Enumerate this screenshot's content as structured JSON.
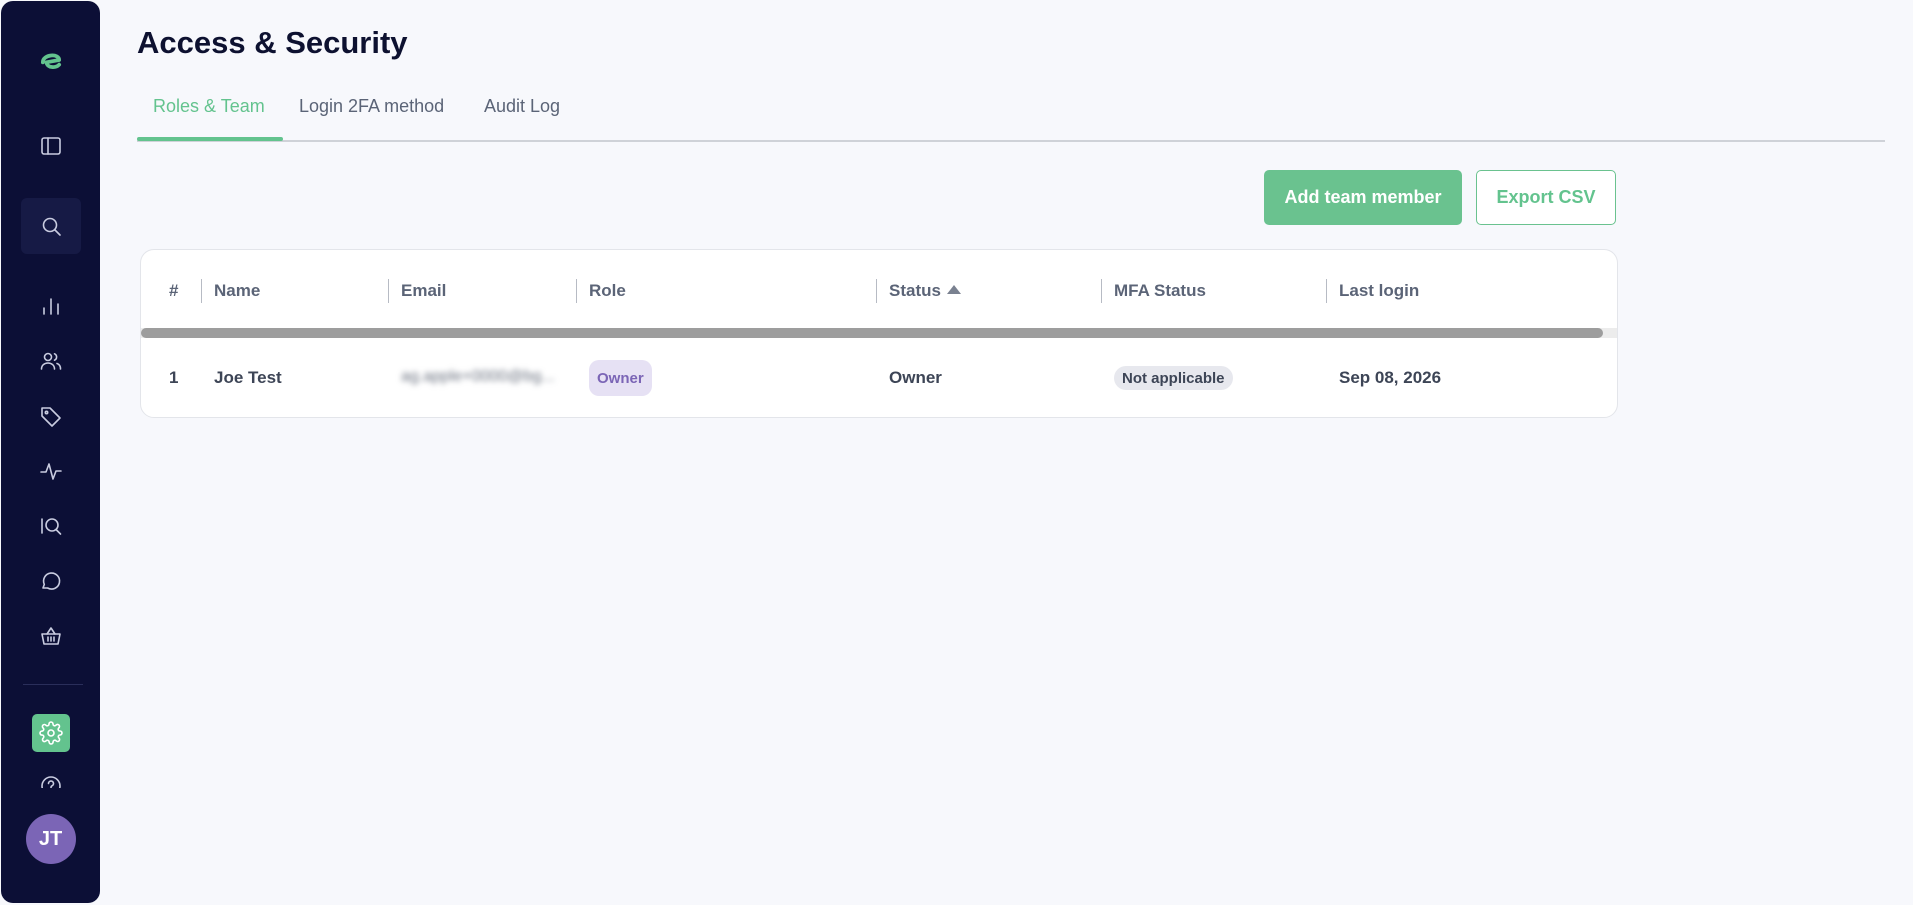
{
  "app": {
    "title": "Access & Security"
  },
  "sidebar": {
    "logo_icon": "brand-logo-icon",
    "items": [
      {
        "name": "sidebar-toggle",
        "icon": "panel-left-icon"
      },
      {
        "name": "search",
        "icon": "search-icon"
      },
      {
        "name": "analytics",
        "icon": "bar-chart-icon"
      },
      {
        "name": "customers",
        "icon": "users-icon"
      },
      {
        "name": "tags",
        "icon": "tag-icon"
      },
      {
        "name": "activity",
        "icon": "activity-icon"
      },
      {
        "name": "iq",
        "icon": "iq-search-icon"
      },
      {
        "name": "messages",
        "icon": "chat-bubble-icon"
      },
      {
        "name": "baskets",
        "icon": "basket-icon"
      },
      {
        "name": "settings",
        "icon": "gear-icon",
        "active": true
      },
      {
        "name": "help",
        "icon": "help-circle-icon"
      }
    ],
    "avatar_initials": "JT",
    "accent_color": "#63c38e"
  },
  "tabs": [
    {
      "label": "Roles & Team",
      "active": true
    },
    {
      "label": "Login 2FA method",
      "active": false
    },
    {
      "label": "Audit Log",
      "active": false
    }
  ],
  "actions": {
    "add_label": "Add team member",
    "export_label": "Export CSV"
  },
  "table": {
    "columns": [
      "#",
      "Name",
      "Email",
      "Role",
      "Status",
      "MFA Status",
      "Last login"
    ],
    "sorted_column": "Status",
    "sort_direction": "asc",
    "rows": [
      {
        "index": "1",
        "name": "Joe Test",
        "email": "ag.apple+0000@bg...",
        "role": "Owner",
        "status": "Owner",
        "mfa_status": "Not applicable",
        "last_login": "Sep 08, 2026"
      }
    ]
  }
}
